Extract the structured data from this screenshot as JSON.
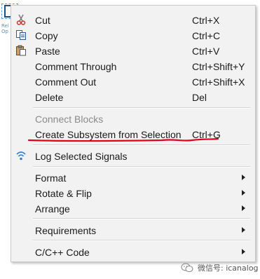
{
  "canvas": {
    "block_text": "Rel\nOp"
  },
  "menu": {
    "items": [
      {
        "label": "Cut",
        "shortcut": "Ctrl+X",
        "icon": "scissors-icon"
      },
      {
        "label": "Copy",
        "shortcut": "Ctrl+C",
        "icon": "copy-icon"
      },
      {
        "label": "Paste",
        "shortcut": "Ctrl+V",
        "icon": "paste-icon"
      },
      {
        "label": "Comment Through",
        "shortcut": "Ctrl+Shift+Y"
      },
      {
        "label": "Comment Out",
        "shortcut": "Ctrl+Shift+X"
      },
      {
        "label": "Delete",
        "shortcut": "Del"
      },
      {
        "label": "Connect Blocks",
        "disabled": true
      },
      {
        "label": "Create Subsystem from Selection",
        "shortcut": "Ctrl+G",
        "annotated": true
      },
      {
        "label": "Log Selected Signals",
        "icon": "signal-wifi-icon"
      },
      {
        "label": "Format",
        "submenu": true
      },
      {
        "label": "Rotate & Flip",
        "submenu": true
      },
      {
        "label": "Arrange",
        "submenu": true
      },
      {
        "label": "Requirements",
        "submenu": true
      },
      {
        "label": "C/C++ Code",
        "submenu": true
      }
    ],
    "annotation_color": "#e0001b"
  },
  "watermark": {
    "text": "微信号: icanalog",
    "icon": "wechat-icon"
  }
}
